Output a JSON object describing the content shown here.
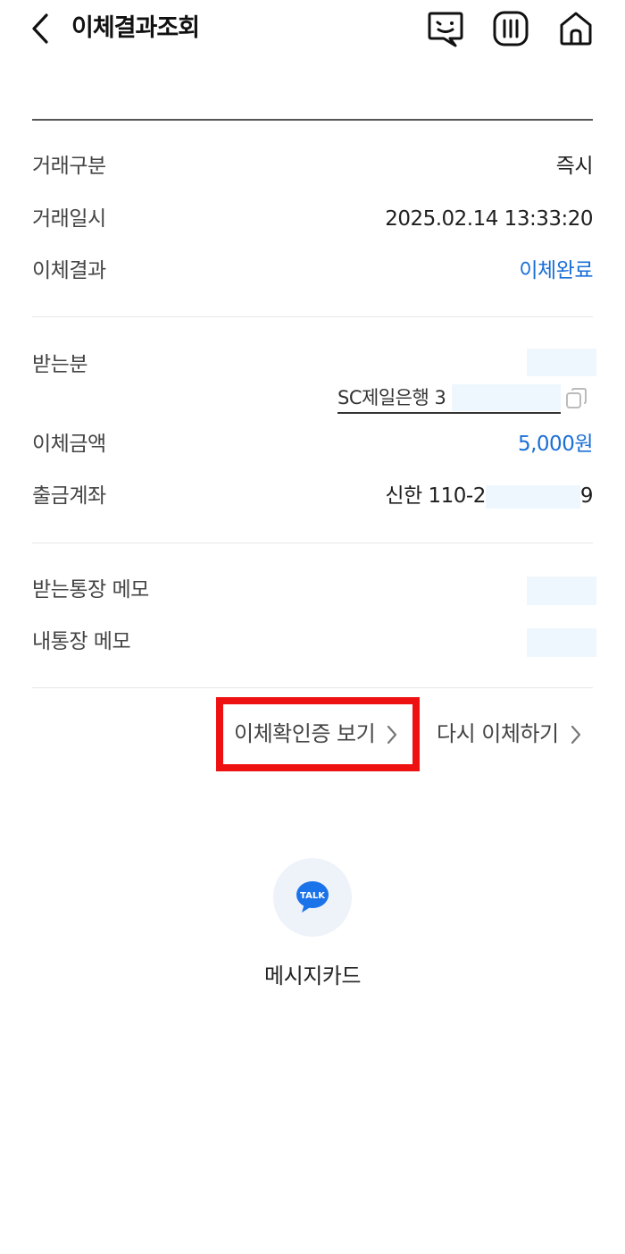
{
  "header": {
    "title": "이체결과조회",
    "icons": [
      "back-icon",
      "chat-icon",
      "menu-icon",
      "home-icon"
    ]
  },
  "details": {
    "type_label": "거래구분",
    "type_value": "즉시",
    "datetime_label": "거래일시",
    "datetime_value": "2025.02.14 13:33:20",
    "result_label": "이체결과",
    "result_value": "이체완료"
  },
  "recipient": {
    "label": "받는분",
    "bank_account": "SC제일은행 3",
    "amount_label": "이체금액",
    "amount_value": "5,000원",
    "from_label": "출금계좌",
    "from_prefix": "신한 110-2",
    "from_suffix": "9"
  },
  "memos": {
    "recipient_memo_label": "받는통장 메모",
    "my_memo_label": "내통장 메모"
  },
  "links": {
    "certificate": "이체확인증 보기",
    "transfer_again": "다시 이체하기"
  },
  "share": {
    "talk_badge": "TALK",
    "label": "메시지카드"
  },
  "colors": {
    "accent_blue": "#1a6fd6",
    "highlight_red": "#ee1111",
    "kakao_blue": "#1a73e8",
    "mask": "#eef7fd"
  }
}
